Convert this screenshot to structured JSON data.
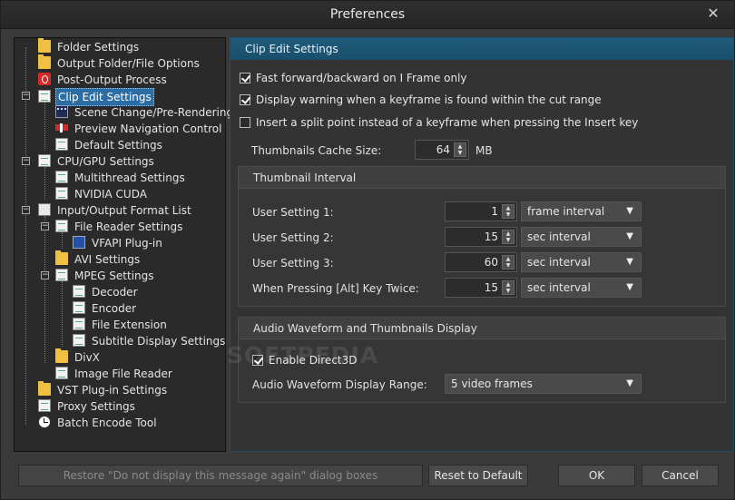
{
  "window": {
    "title": "Preferences",
    "close_glyph": "✕"
  },
  "tree": {
    "items": [
      {
        "label": "Folder Settings",
        "icon": "folder-icon"
      },
      {
        "label": "Output Folder/File Options",
        "icon": "folder-doc-icon"
      },
      {
        "label": "Post-Output Process",
        "icon": "power-icon"
      },
      {
        "label": "Clip Edit Settings",
        "icon": "document-icon"
      },
      {
        "label": "Scene Change/Pre-Rendering",
        "icon": "filmstrip-icon"
      },
      {
        "label": "Preview Navigation Control",
        "icon": "navigation-icon"
      },
      {
        "label": "Default Settings",
        "icon": "document-icon"
      },
      {
        "label": "CPU/GPU Settings",
        "icon": "document-icon"
      },
      {
        "label": "Multithread Settings",
        "icon": "document-icon"
      },
      {
        "label": "NVIDIA CUDA",
        "icon": "document-icon"
      },
      {
        "label": "Input/Output Format List",
        "icon": "list-icon"
      },
      {
        "label": "File Reader Settings",
        "icon": "document-icon"
      },
      {
        "label": "VFAPI Plug-in",
        "icon": "monitor-icon"
      },
      {
        "label": "AVI Settings",
        "icon": "folder-doc-icon"
      },
      {
        "label": "MPEG Settings",
        "icon": "document-icon"
      },
      {
        "label": "Decoder",
        "icon": "document-icon"
      },
      {
        "label": "Encoder",
        "icon": "document-icon"
      },
      {
        "label": "File Extension",
        "icon": "document-icon"
      },
      {
        "label": "Subtitle Display Settings",
        "icon": "document-icon"
      },
      {
        "label": "DivX",
        "icon": "folder-doc-icon"
      },
      {
        "label": "Image File Reader",
        "icon": "document-icon"
      },
      {
        "label": "VST Plug-in Settings",
        "icon": "folder-doc-icon"
      },
      {
        "label": "Proxy Settings",
        "icon": "document-icon"
      },
      {
        "label": "Batch Encode Tool",
        "icon": "clock-icon"
      }
    ]
  },
  "panel": {
    "header": "Clip Edit Settings",
    "checks": [
      {
        "label": "Fast forward/backward on I Frame only",
        "checked": true
      },
      {
        "label": "Display warning when a keyframe is found within the cut range",
        "checked": true
      },
      {
        "label": "Insert a split point instead of a keyframe when pressing the Insert key",
        "checked": false
      }
    ],
    "cache": {
      "label": "Thumbnails Cache Size:",
      "value": "64",
      "unit": "MB"
    },
    "interval_group": {
      "title": "Thumbnail Interval",
      "rows": [
        {
          "label": "User Setting 1:",
          "value": "1",
          "unit": "frame interval"
        },
        {
          "label": "User Setting 2:",
          "value": "15",
          "unit": "sec interval"
        },
        {
          "label": "User Setting 3:",
          "value": "60",
          "unit": "sec interval"
        },
        {
          "label": "When Pressing [Alt] Key Twice:",
          "value": "15",
          "unit": "sec interval"
        }
      ]
    },
    "audio_group": {
      "title": "Audio Waveform and Thumbnails Display",
      "direct3d": {
        "label": "Enable Direct3D",
        "checked": true
      },
      "range": {
        "label": "Audio Waveform Display Range:",
        "value": "5 video frames"
      }
    },
    "watermark": "SOFTPEDIA"
  },
  "footer": {
    "restore": "Restore \"Do not display this message again\" dialog boxes",
    "reset": "Reset to Default",
    "ok": "OK",
    "cancel": "Cancel"
  }
}
